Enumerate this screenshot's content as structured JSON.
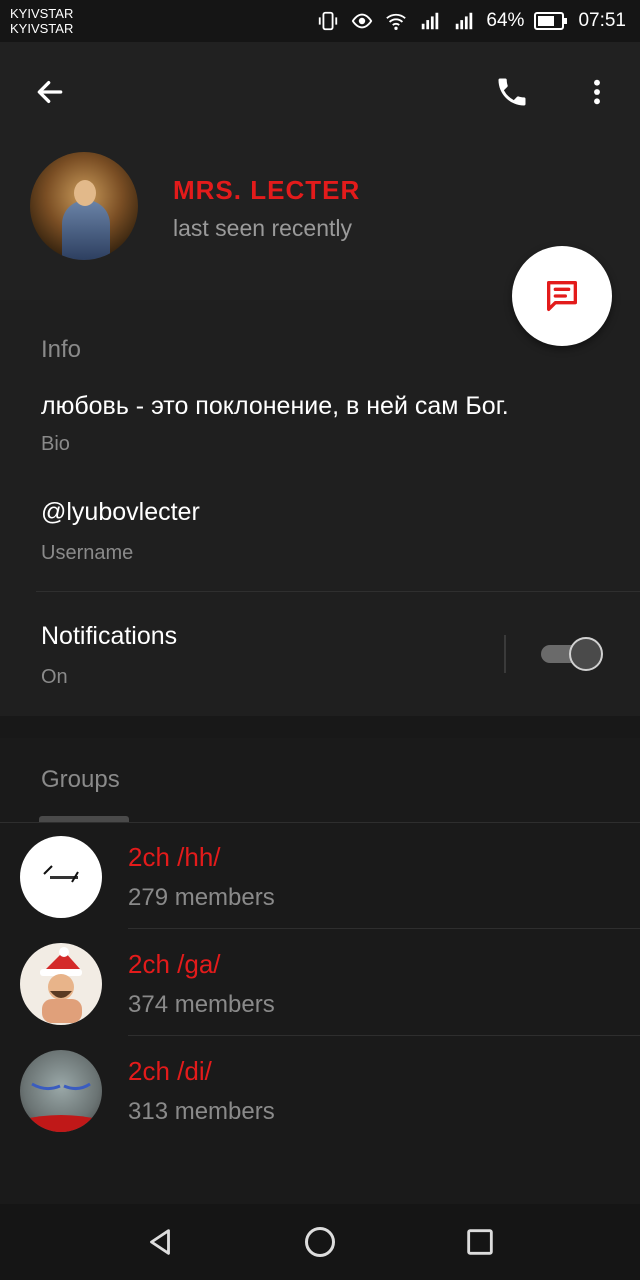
{
  "status_bar": {
    "carrier_1": "KYIVSTAR",
    "carrier_2": "KYIVSTAR",
    "battery": "64%",
    "time": "07:51"
  },
  "header": {
    "back_icon": "arrow-left-icon",
    "call_icon": "phone-icon",
    "menu_icon": "more-vertical-icon",
    "name": "MRS. LECTER",
    "status": "last seen recently",
    "fab_icon": "message-icon"
  },
  "info": {
    "title": "Info",
    "bio_value": "любовь - это поклонение, в ней сам Бог.",
    "bio_label": "Bio",
    "username_value": "@lyubovlecter",
    "username_label": "Username",
    "notifications_label": "Notifications",
    "notifications_state": "On",
    "notifications_enabled": true
  },
  "groups": {
    "tab_label": "Groups",
    "items": [
      {
        "name": "2ch /hh/",
        "members": "279 members"
      },
      {
        "name": "2ch /ga/",
        "members": "374 members"
      },
      {
        "name": "2ch /di/",
        "members": "313 members"
      }
    ]
  },
  "colors": {
    "accent": "#e31b1b",
    "background": "#1a1a1a",
    "secondary_text": "#8a8a8a"
  }
}
